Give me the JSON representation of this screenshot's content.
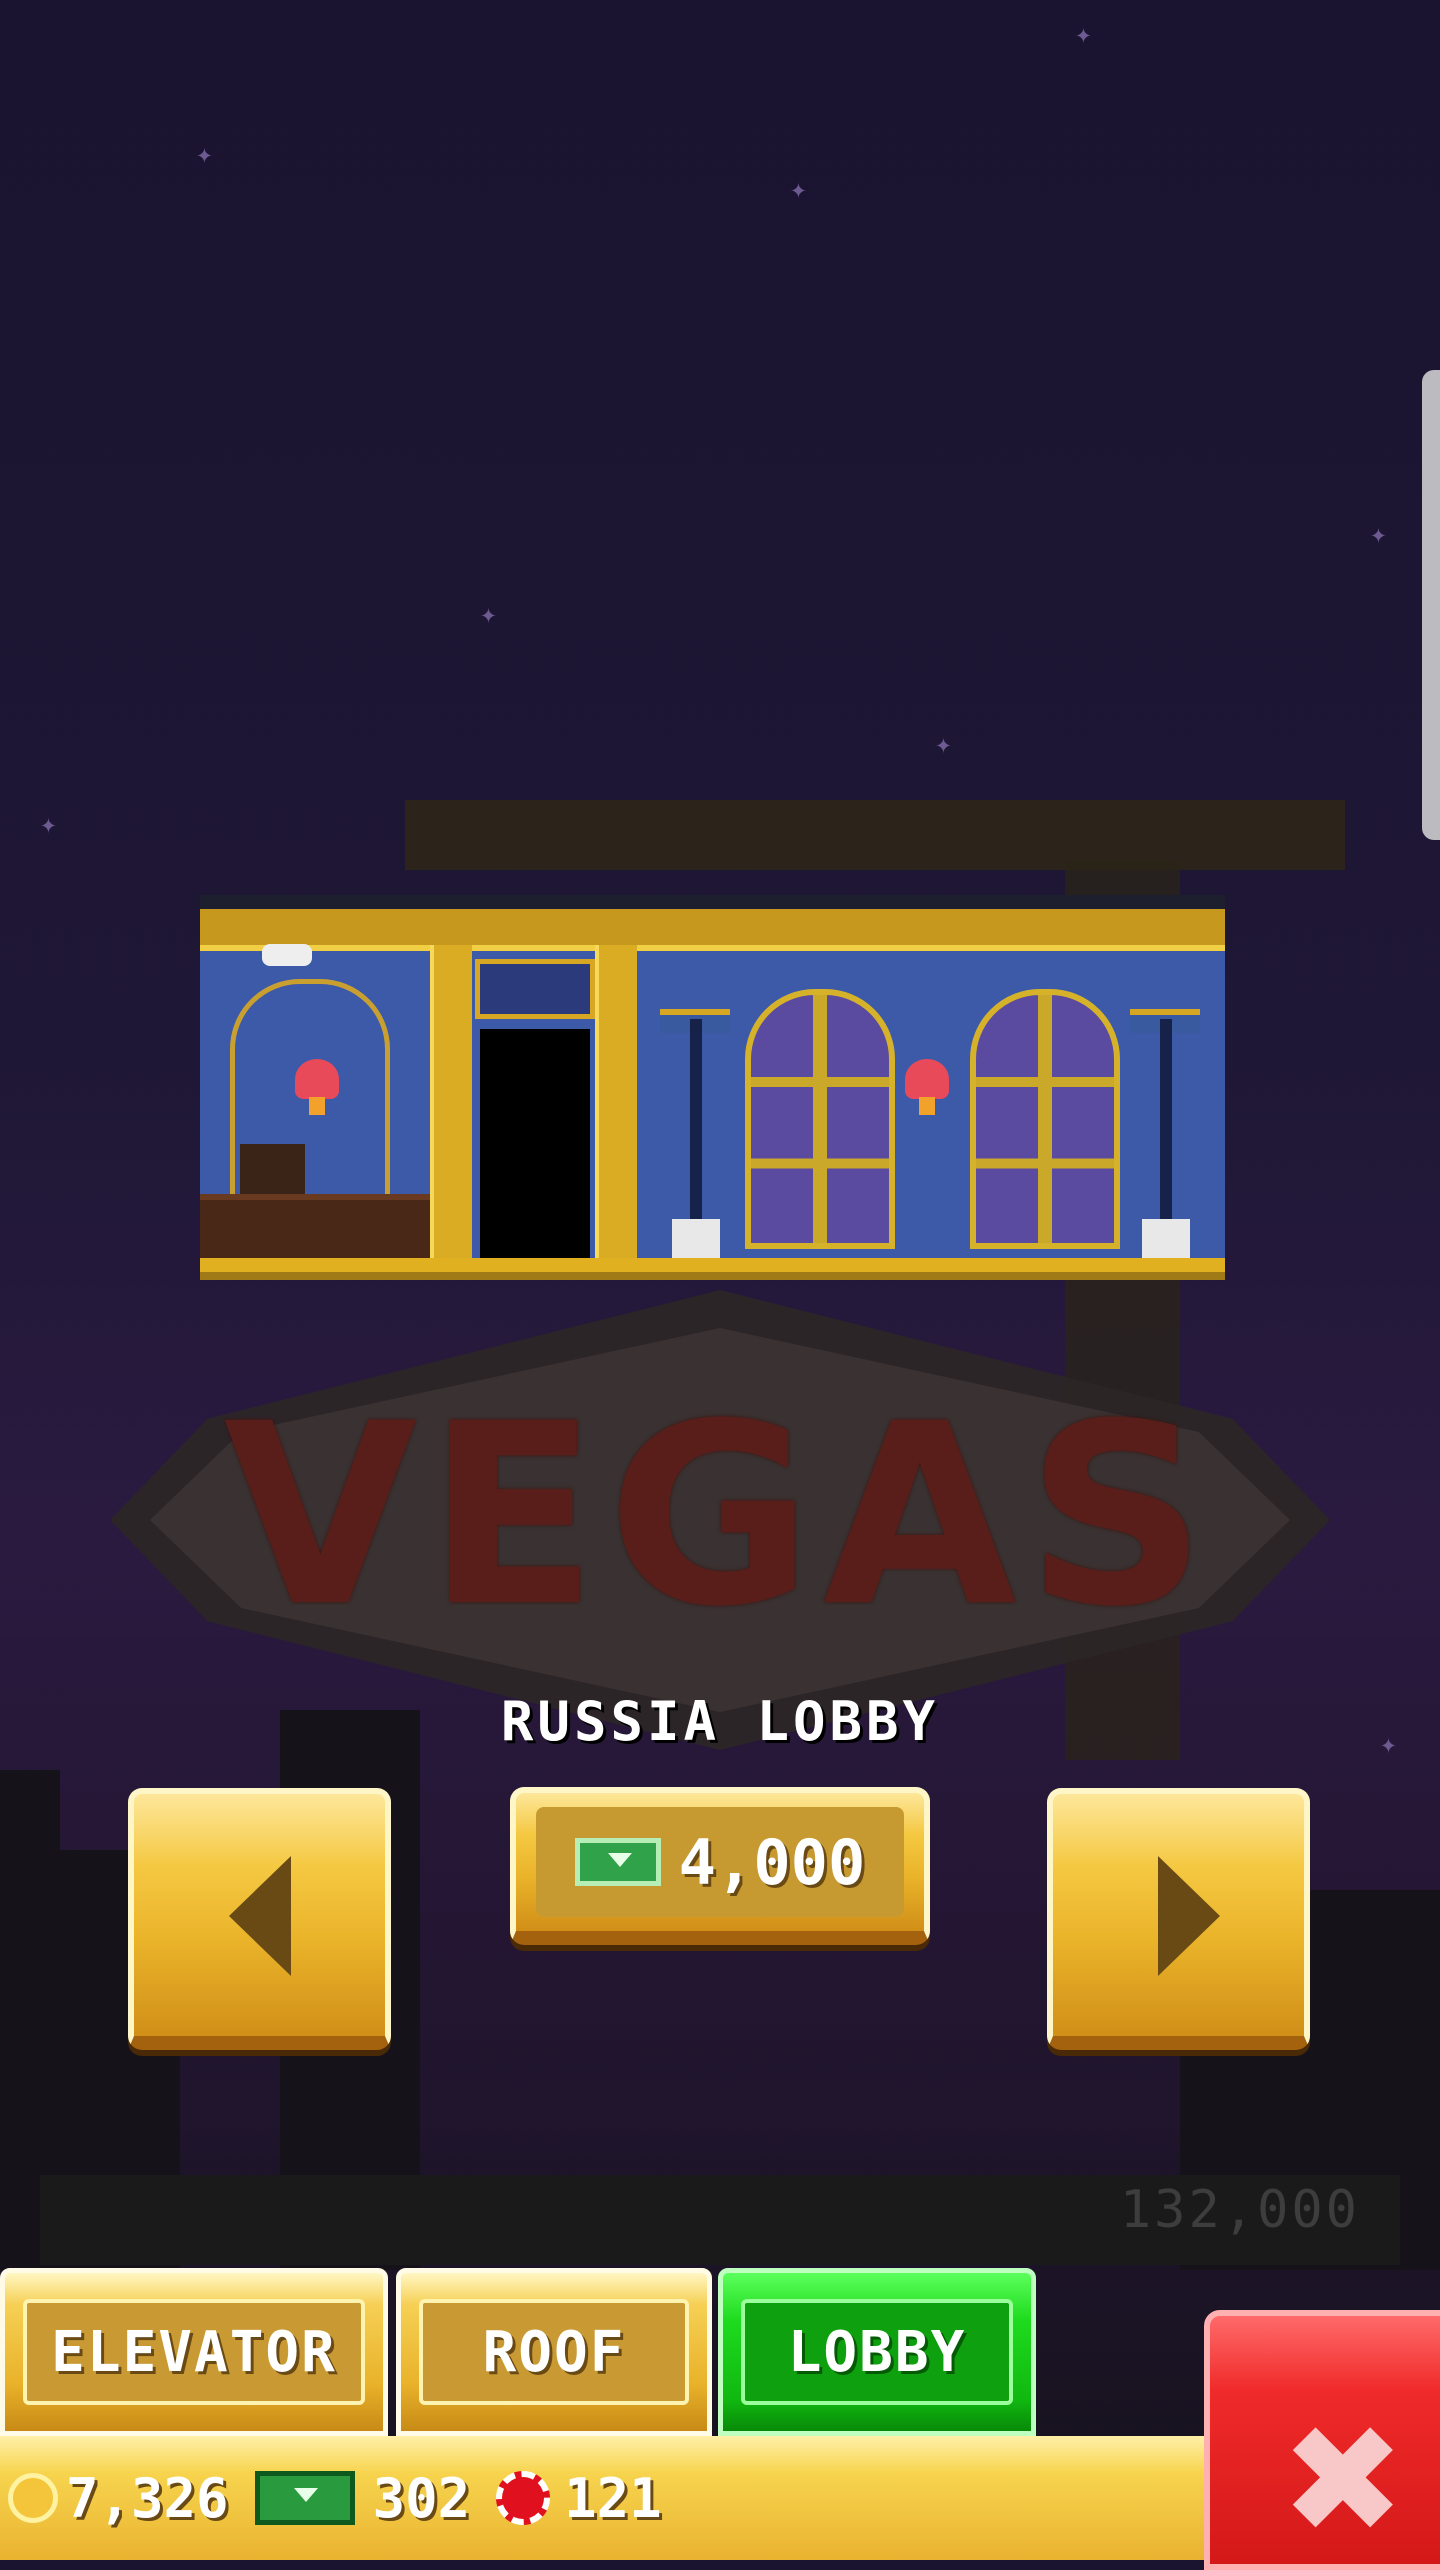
{
  "screen": {
    "item_title": "RUSSIA LOBBY",
    "background_sign_text": "VEGAS",
    "background_figure": "132,000"
  },
  "buy_button": {
    "price": "4,000",
    "currency_icon": "bux-cash-icon"
  },
  "nav": {
    "prev_icon": "left-arrow-icon",
    "next_icon": "right-arrow-icon"
  },
  "tabs": [
    {
      "label": "ELEVATOR",
      "active": false
    },
    {
      "label": "ROOF",
      "active": false
    },
    {
      "label": "LOBBY",
      "active": true
    }
  ],
  "status": {
    "coins": "7,326",
    "bux": "302",
    "chips": "121"
  },
  "close_button": {
    "icon": "close-x-icon"
  },
  "colors": {
    "gold": "#f5c842",
    "active_tab_green": "#1edb1e",
    "close_red": "#f02a2a",
    "night_sky": "#1e1735"
  }
}
